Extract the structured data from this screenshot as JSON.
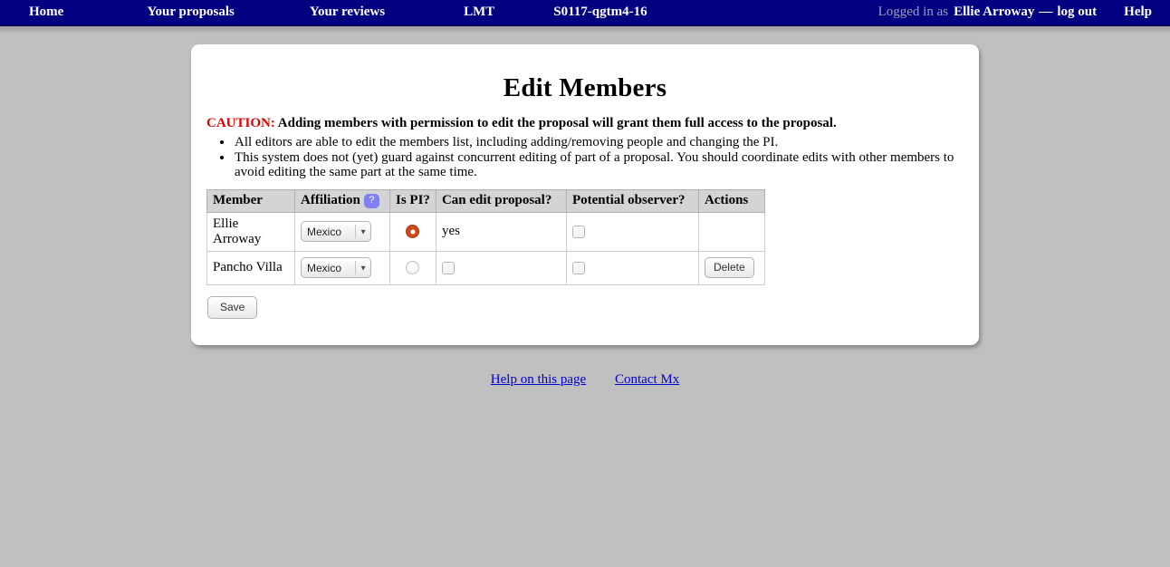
{
  "navbar": {
    "items": [
      {
        "label": "Home",
        "name": "nav-home"
      },
      {
        "label": "Your proposals",
        "name": "nav-your-proposals"
      },
      {
        "label": "Your reviews",
        "name": "nav-your-reviews"
      },
      {
        "label": "LMT",
        "name": "nav-lmt"
      },
      {
        "label": "S0117-qgtm4-16",
        "name": "nav-proposal-id"
      }
    ],
    "logged_in_prefix": "Logged in as",
    "user_name": "Ellie Arroway",
    "separator": "—",
    "logout_label": "log out",
    "help_label": "Help"
  },
  "main": {
    "title": "Edit Members",
    "caution_label": "CAUTION:",
    "caution_text": "Adding members with permission to edit the proposal will grant them full access to the proposal.",
    "notes": [
      "All editors are able to edit the members list, including adding/removing people and changing the PI.",
      "This system does not (yet) guard against concurrent editing of part of a proposal. You should coordinate edits with other members to avoid editing the same part at the same time."
    ],
    "save_label": "Save"
  },
  "table": {
    "columns": [
      {
        "label": "Member",
        "name": "col-member"
      },
      {
        "label": "Affiliation",
        "name": "col-affiliation",
        "help_badge": "?"
      },
      {
        "label": "Is PI?",
        "name": "col-is-pi"
      },
      {
        "label": "Can edit proposal?",
        "name": "col-can-edit"
      },
      {
        "label": "Potential observer?",
        "name": "col-potential-observer"
      },
      {
        "label": "Actions",
        "name": "col-actions"
      }
    ],
    "rows": [
      {
        "member": "Ellie Arroway",
        "affiliation": "Mexico",
        "is_pi": true,
        "can_edit_text": "yes",
        "can_edit_checkbox": false,
        "has_can_edit_checkbox": false,
        "potential_observer": false,
        "delete_label": "",
        "has_delete": false
      },
      {
        "member": "Pancho Villa",
        "affiliation": "Mexico",
        "is_pi": false,
        "can_edit_text": "",
        "can_edit_checkbox": false,
        "has_can_edit_checkbox": true,
        "potential_observer": false,
        "delete_label": "Delete",
        "has_delete": true
      }
    ]
  },
  "footer": {
    "help_page_label": "Help on this page",
    "contact_label": "Contact Mx"
  },
  "colors": {
    "navbar_bg": "#000080",
    "page_bg": "#c0c0c0",
    "caution_red": "#e00000",
    "link_blue": "#0000d0",
    "badge_purple": "#8080f0",
    "radio_checked": "#cf4a18",
    "table_header_bg": "#d4d4d4"
  }
}
